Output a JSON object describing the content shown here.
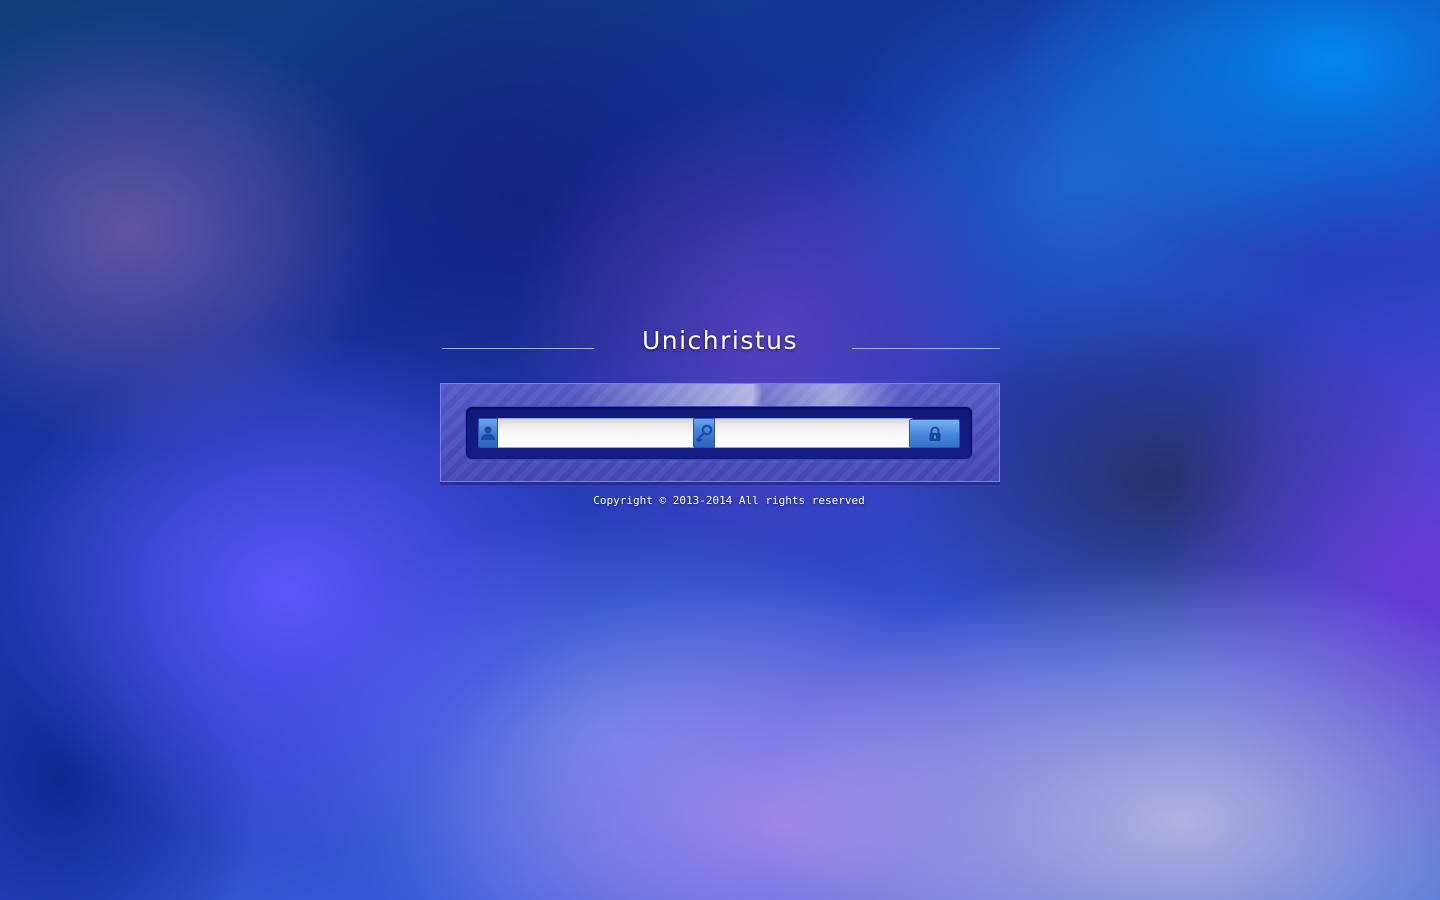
{
  "app": {
    "title": "Unichristus"
  },
  "login": {
    "username": {
      "icon": "user-icon",
      "value": "",
      "placeholder": ""
    },
    "password": {
      "icon": "key-icon",
      "value": "",
      "placeholder": ""
    },
    "submit": {
      "icon": "lock-icon"
    }
  },
  "footer": {
    "copyright": "Copyright © 2013-2014 All rights reserved"
  },
  "colors": {
    "accent": "#3b7ad6",
    "panel": "#141c8a"
  }
}
